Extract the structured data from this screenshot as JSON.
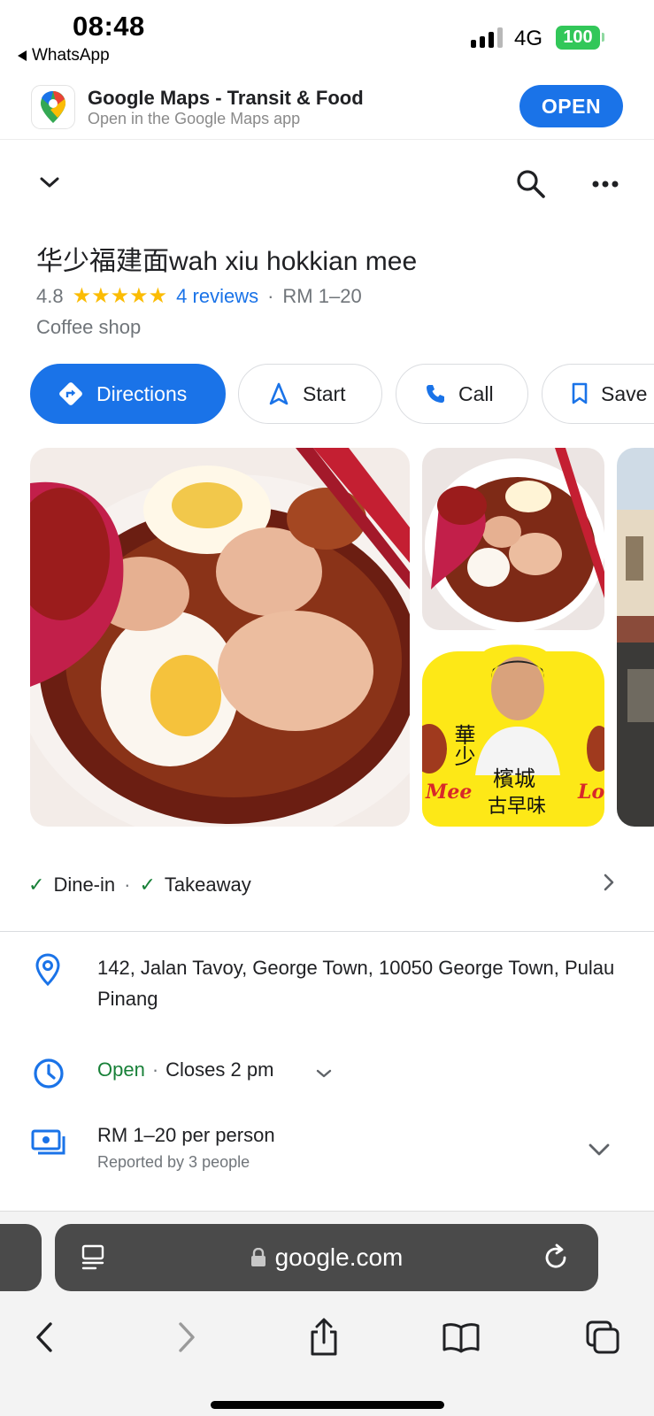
{
  "status_bar": {
    "time": "08:48",
    "back_app": "WhatsApp",
    "network": "4G",
    "battery": "100"
  },
  "app_banner": {
    "title": "Google Maps - Transit & Food",
    "subtitle": "Open in the Google Maps app",
    "open_label": "OPEN"
  },
  "toolbar": {
    "collapse_icon": "chevron-down-icon",
    "search_icon": "search-icon",
    "more_icon": "more-horiz-icon"
  },
  "place": {
    "name": "华少福建面wah xiu hokkian mee",
    "rating": "4.8",
    "stars": "★★★★★",
    "reviews": "4 reviews",
    "separator": "·",
    "price_range": "RM 1–20",
    "category": "Coffee shop"
  },
  "actions": {
    "directions": "Directions",
    "start": "Start",
    "call": "Call",
    "save": "Save"
  },
  "service_options": {
    "dine_in": "Dine-in",
    "takeaway": "Takeaway",
    "check": "✓",
    "separator": "·"
  },
  "info": {
    "address": "142, Jalan Tavoy, George Town, 10050 George Town, Pulau Pinang",
    "hours_status": "Open",
    "hours_separator": "·",
    "hours_close": "Closes 2 pm",
    "price": "RM 1–20 per person",
    "price_note": "Reported by 3 people"
  },
  "photos": {
    "sign_text_1": "華少",
    "sign_text_2": "檳城",
    "sign_text_3": "古早味",
    "sign_left": "Mee",
    "sign_right": "Lo"
  },
  "browser": {
    "url": "google.com"
  },
  "colors": {
    "accent": "#1a73e8",
    "open_green": "#188038",
    "star": "#fbbc04"
  }
}
